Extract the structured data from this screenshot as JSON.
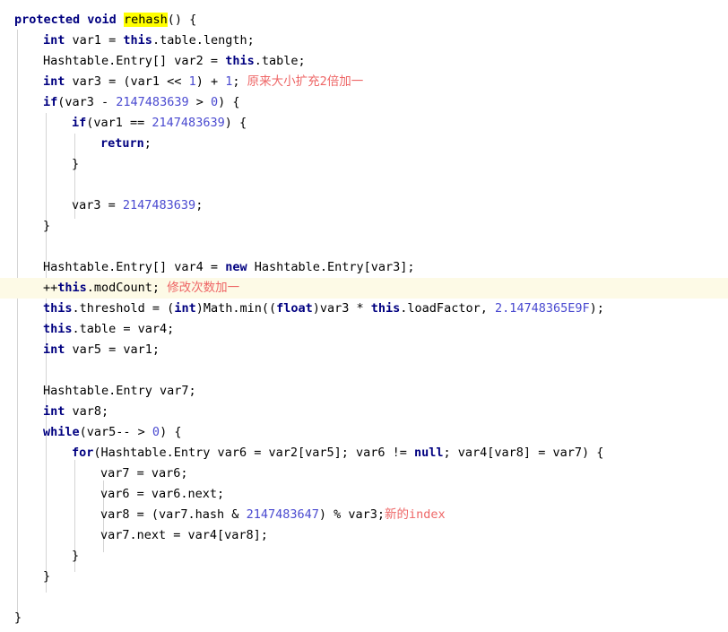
{
  "editor": {
    "language": "java",
    "method_name": "rehash",
    "highlighted_search_term": "rehash",
    "current_line_index": 14,
    "colors": {
      "background": "#ffffff",
      "keyword": "#000080",
      "number": "#4a4ad0",
      "plain": "#000000",
      "comment": "#f07878",
      "search_highlight": "#ffff00",
      "caret_line_highlight": "#fdfae6",
      "indent_guide": "#d4d4d4"
    },
    "indent_guides_x": [
      19,
      51,
      83,
      115
    ]
  },
  "code": {
    "lines": [
      {
        "n": 1,
        "indent": 0,
        "highlight": false,
        "tokens": [
          {
            "t": "kw",
            "v": "protected"
          },
          {
            "t": "pln",
            "v": " "
          },
          {
            "t": "kw",
            "v": "void"
          },
          {
            "t": "pln",
            "v": " "
          },
          {
            "t": "mark",
            "v": "rehash"
          },
          {
            "t": "pln",
            "v": "() {"
          }
        ]
      },
      {
        "n": 2,
        "indent": 1,
        "highlight": false,
        "tokens": [
          {
            "t": "kw",
            "v": "int"
          },
          {
            "t": "pln",
            "v": " var1 = "
          },
          {
            "t": "kw",
            "v": "this"
          },
          {
            "t": "pln",
            "v": ".table.length;"
          }
        ]
      },
      {
        "n": 3,
        "indent": 1,
        "highlight": false,
        "tokens": [
          {
            "t": "pln",
            "v": "Hashtable.Entry[] var2 = "
          },
          {
            "t": "kw",
            "v": "this"
          },
          {
            "t": "pln",
            "v": ".table;"
          }
        ]
      },
      {
        "n": 4,
        "indent": 1,
        "highlight": false,
        "tokens": [
          {
            "t": "kw",
            "v": "int"
          },
          {
            "t": "pln",
            "v": " var3 = (var1 << "
          },
          {
            "t": "num",
            "v": "1"
          },
          {
            "t": "pln",
            "v": ") + "
          },
          {
            "t": "num",
            "v": "1"
          },
          {
            "t": "pln",
            "v": "; "
          },
          {
            "t": "cmt-cn",
            "v": "原来大小扩充2倍加一"
          }
        ]
      },
      {
        "n": 5,
        "indent": 1,
        "highlight": false,
        "tokens": [
          {
            "t": "kw",
            "v": "if"
          },
          {
            "t": "pln",
            "v": "(var3 - "
          },
          {
            "t": "num",
            "v": "2147483639"
          },
          {
            "t": "pln",
            "v": " > "
          },
          {
            "t": "num",
            "v": "0"
          },
          {
            "t": "pln",
            "v": ") {"
          }
        ]
      },
      {
        "n": 6,
        "indent": 2,
        "highlight": false,
        "tokens": [
          {
            "t": "kw",
            "v": "if"
          },
          {
            "t": "pln",
            "v": "(var1 == "
          },
          {
            "t": "num",
            "v": "2147483639"
          },
          {
            "t": "pln",
            "v": ") {"
          }
        ]
      },
      {
        "n": 7,
        "indent": 3,
        "highlight": false,
        "tokens": [
          {
            "t": "kw",
            "v": "return"
          },
          {
            "t": "pln",
            "v": ";"
          }
        ]
      },
      {
        "n": 8,
        "indent": 2,
        "highlight": false,
        "tokens": [
          {
            "t": "pln",
            "v": "}"
          }
        ]
      },
      {
        "n": 9,
        "indent": 0,
        "highlight": false,
        "tokens": []
      },
      {
        "n": 10,
        "indent": 2,
        "highlight": false,
        "tokens": [
          {
            "t": "pln",
            "v": "var3 = "
          },
          {
            "t": "num",
            "v": "2147483639"
          },
          {
            "t": "pln",
            "v": ";"
          }
        ]
      },
      {
        "n": 11,
        "indent": 1,
        "highlight": false,
        "tokens": [
          {
            "t": "pln",
            "v": "}"
          }
        ]
      },
      {
        "n": 12,
        "indent": 0,
        "highlight": false,
        "tokens": []
      },
      {
        "n": 13,
        "indent": 1,
        "highlight": false,
        "tokens": [
          {
            "t": "pln",
            "v": "Hashtable.Entry[] var4 = "
          },
          {
            "t": "kw",
            "v": "new"
          },
          {
            "t": "pln",
            "v": " Hashtable.Entry[var3];"
          }
        ]
      },
      {
        "n": 14,
        "indent": 1,
        "highlight": true,
        "tokens": [
          {
            "t": "pln",
            "v": "++"
          },
          {
            "t": "kw",
            "v": "this"
          },
          {
            "t": "pln",
            "v": ".modCount; "
          },
          {
            "t": "cmt-cn",
            "v": "修改次数加一"
          }
        ]
      },
      {
        "n": 15,
        "indent": 1,
        "highlight": false,
        "tokens": [
          {
            "t": "kw",
            "v": "this"
          },
          {
            "t": "pln",
            "v": ".threshold = ("
          },
          {
            "t": "kw",
            "v": "int"
          },
          {
            "t": "pln",
            "v": ")Math.min(("
          },
          {
            "t": "kw",
            "v": "float"
          },
          {
            "t": "pln",
            "v": ")var3 * "
          },
          {
            "t": "kw",
            "v": "this"
          },
          {
            "t": "pln",
            "v": ".loadFactor, "
          },
          {
            "t": "num",
            "v": "2.14748365E9F"
          },
          {
            "t": "pln",
            "v": ");"
          }
        ]
      },
      {
        "n": 16,
        "indent": 1,
        "highlight": false,
        "tokens": [
          {
            "t": "kw",
            "v": "this"
          },
          {
            "t": "pln",
            "v": ".table = var4;"
          }
        ]
      },
      {
        "n": 17,
        "indent": 1,
        "highlight": false,
        "tokens": [
          {
            "t": "kw",
            "v": "int"
          },
          {
            "t": "pln",
            "v": " var5 = var1;"
          }
        ]
      },
      {
        "n": 18,
        "indent": 0,
        "highlight": false,
        "tokens": []
      },
      {
        "n": 19,
        "indent": 1,
        "highlight": false,
        "tokens": [
          {
            "t": "pln",
            "v": "Hashtable.Entry var7;"
          }
        ]
      },
      {
        "n": 20,
        "indent": 1,
        "highlight": false,
        "tokens": [
          {
            "t": "kw",
            "v": "int"
          },
          {
            "t": "pln",
            "v": " var8;"
          }
        ]
      },
      {
        "n": 21,
        "indent": 1,
        "highlight": false,
        "tokens": [
          {
            "t": "kw",
            "v": "while"
          },
          {
            "t": "pln",
            "v": "(var5-- > "
          },
          {
            "t": "num",
            "v": "0"
          },
          {
            "t": "pln",
            "v": ") {"
          }
        ]
      },
      {
        "n": 22,
        "indent": 2,
        "highlight": false,
        "tokens": [
          {
            "t": "kw",
            "v": "for"
          },
          {
            "t": "pln",
            "v": "(Hashtable.Entry var6 = var2[var5]; var6 != "
          },
          {
            "t": "kw",
            "v": "null"
          },
          {
            "t": "pln",
            "v": "; var4[var8] = var7) {"
          }
        ]
      },
      {
        "n": 23,
        "indent": 3,
        "highlight": false,
        "tokens": [
          {
            "t": "pln",
            "v": "var7 = var6;"
          }
        ]
      },
      {
        "n": 24,
        "indent": 3,
        "highlight": false,
        "tokens": [
          {
            "t": "pln",
            "v": "var6 = var6.next;"
          }
        ]
      },
      {
        "n": 25,
        "indent": 3,
        "highlight": false,
        "tokens": [
          {
            "t": "pln",
            "v": "var8 = (var7.hash & "
          },
          {
            "t": "num",
            "v": "2147483647"
          },
          {
            "t": "pln",
            "v": ") % var3;"
          },
          {
            "t": "cmt-cn",
            "v": "新的index"
          }
        ]
      },
      {
        "n": 26,
        "indent": 3,
        "highlight": false,
        "tokens": [
          {
            "t": "pln",
            "v": "var7.next = var4[var8];"
          }
        ]
      },
      {
        "n": 27,
        "indent": 2,
        "highlight": false,
        "tokens": [
          {
            "t": "pln",
            "v": "}"
          }
        ]
      },
      {
        "n": 28,
        "indent": 1,
        "highlight": false,
        "tokens": [
          {
            "t": "pln",
            "v": "}"
          }
        ]
      },
      {
        "n": 29,
        "indent": 0,
        "highlight": false,
        "tokens": []
      },
      {
        "n": 30,
        "indent": 0,
        "highlight": false,
        "tokens": [
          {
            "t": "pln",
            "v": "}"
          }
        ]
      }
    ]
  }
}
